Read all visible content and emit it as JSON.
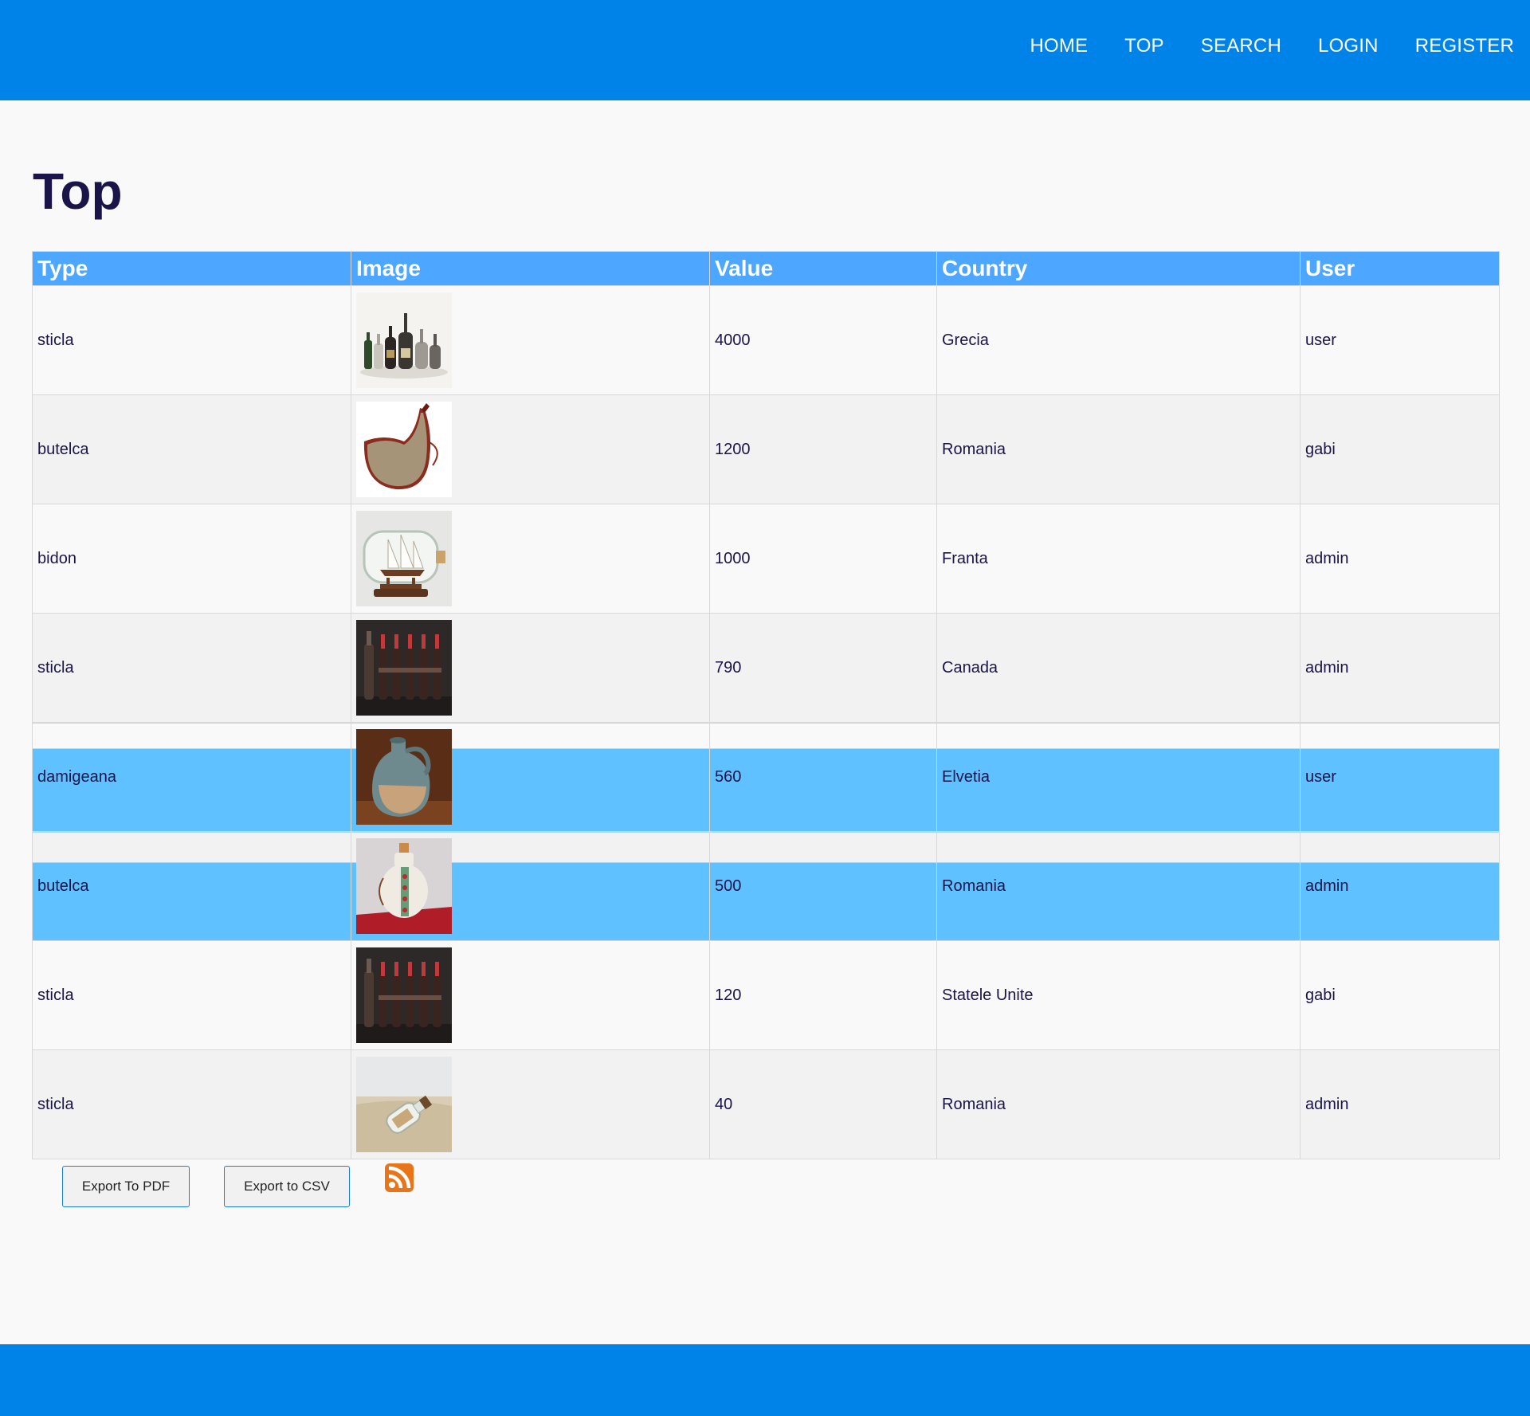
{
  "nav": {
    "items": [
      {
        "label": "HOME"
      },
      {
        "label": "TOP"
      },
      {
        "label": "SEARCH"
      },
      {
        "label": "LOGIN"
      },
      {
        "label": "REGISTER"
      }
    ]
  },
  "page": {
    "title": "Top"
  },
  "table": {
    "headers": [
      "Type",
      "Image",
      "Value",
      "Country",
      "User"
    ],
    "rows": [
      {
        "type": "sticla",
        "image": "bottles-collection-image",
        "value": "4000",
        "country": "Grecia",
        "user": "user",
        "highlighted": false
      },
      {
        "type": "butelca",
        "image": "leather-flask-image",
        "value": "1200",
        "country": "Romania",
        "user": "gabi",
        "highlighted": false
      },
      {
        "type": "bidon",
        "image": "ship-in-bottle-image",
        "value": "1000",
        "country": "Franta",
        "user": "admin",
        "highlighted": false
      },
      {
        "type": "sticla",
        "image": "dark-bottles-row-image",
        "value": "790",
        "country": "Canada",
        "user": "admin",
        "highlighted": false
      },
      {
        "type": "damigeana",
        "image": "ceramic-jug-image",
        "value": "560",
        "country": "Elvetia",
        "user": "user",
        "highlighted": true
      },
      {
        "type": "butelca",
        "image": "painted-flask-image",
        "value": "500",
        "country": "Romania",
        "user": "admin",
        "highlighted": true
      },
      {
        "type": "sticla",
        "image": "dark-bottles-row-image",
        "value": "120",
        "country": "Statele Unite",
        "user": "gabi",
        "highlighted": false
      },
      {
        "type": "sticla",
        "image": "bottle-in-sand-image",
        "value": "40",
        "country": "Romania",
        "user": "admin",
        "highlighted": false
      }
    ]
  },
  "actions": {
    "export_pdf_label": "Export To PDF",
    "export_csv_label": "Export to CSV",
    "rss_icon": "rss-icon"
  },
  "colors": {
    "header_bar": "#0083e8",
    "table_header": "#4da6ff",
    "row_highlight": "#5fc1ff",
    "title_text": "#1a1448",
    "rss_orange": "#e8751a"
  }
}
